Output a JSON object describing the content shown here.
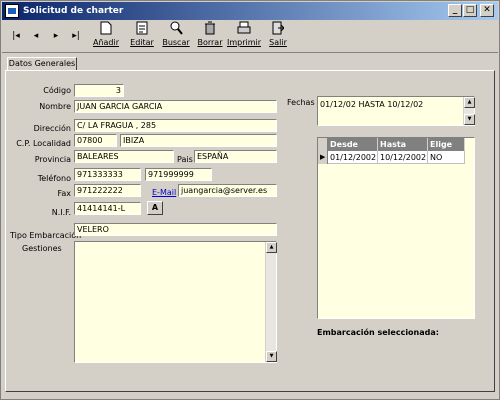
{
  "window": {
    "title": "Solicitud de charter",
    "controls": [
      "_",
      "□",
      "✕"
    ]
  },
  "toolbar": {
    "nav": [
      "|◂",
      "◂",
      "▸",
      "▸|"
    ],
    "buttons": [
      {
        "label": "Añadir",
        "icon": "document-icon"
      },
      {
        "label": "Editar",
        "icon": "edit-icon"
      },
      {
        "label": "Buscar",
        "icon": "search-icon"
      },
      {
        "label": "Borrar",
        "icon": "trash-icon"
      },
      {
        "label": "Imprimir",
        "icon": "printer-icon"
      },
      {
        "label": "Salir",
        "icon": "exit-icon"
      }
    ]
  },
  "tabs": [
    {
      "label": "Datos Generales"
    }
  ],
  "form": {
    "codigo": {
      "label": "Código",
      "value": "3"
    },
    "nombre": {
      "label": "Nombre",
      "value": "JUAN GARCIA GARCIA"
    },
    "direccion": {
      "label": "Dirección",
      "value": "C/ LA FRAGUA , 285"
    },
    "cp_localidad": {
      "label": "C.P. Localidad",
      "cp": "07800",
      "localidad": "IBIZA"
    },
    "provincia": {
      "label": "Provincia",
      "value": "BALEARES"
    },
    "pais": {
      "label": "Pais",
      "value": "ESPAÑA"
    },
    "telefono": {
      "label": "Teléfono",
      "value1": "971333333",
      "value2": "971999999"
    },
    "fax": {
      "label": "Fax",
      "value": "971222222"
    },
    "email": {
      "label": "E-Mail",
      "value": "juangarcia@server.es"
    },
    "nif": {
      "label": "N.I.F.",
      "value": "41414141-L",
      "button": "A"
    },
    "tipo_embarcacion": {
      "label": "Tipo Embarcación",
      "value": "VELERO"
    },
    "gestiones": {
      "label": "Gestiones",
      "value": ""
    }
  },
  "fechas": {
    "label": "Fechas",
    "value": "01/12/02 HASTA 10/12/02"
  },
  "table": {
    "columns": [
      "Desde",
      "Hasta",
      "Elige"
    ],
    "rows": [
      [
        "01/12/2002",
        "10/12/2002",
        "NO"
      ]
    ]
  },
  "embarcacion_label": "Embarcación seleccionada:"
}
